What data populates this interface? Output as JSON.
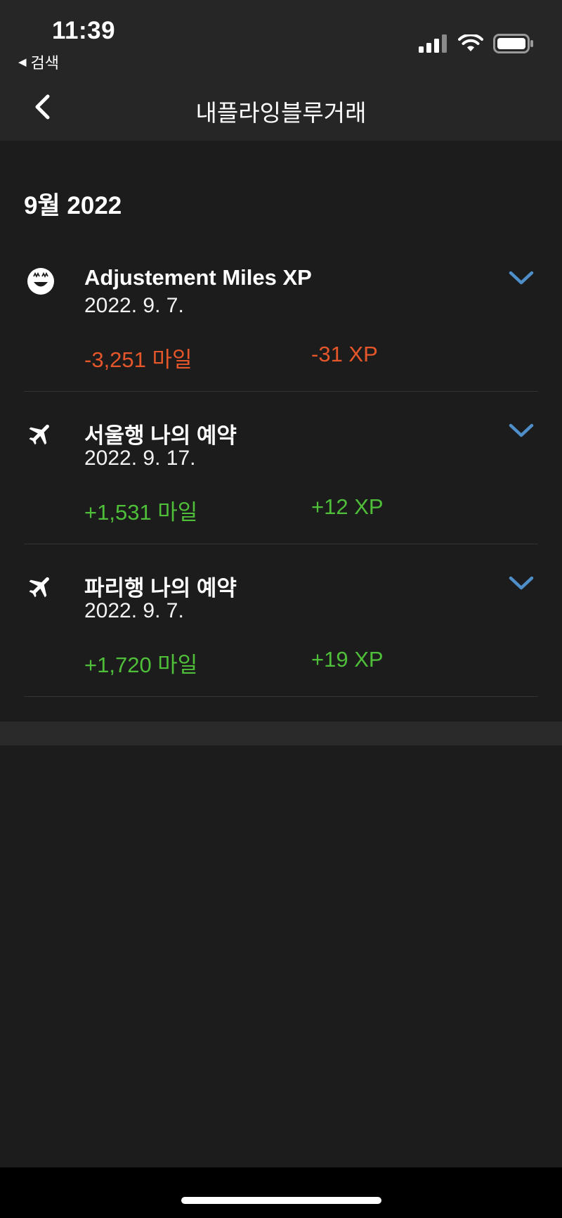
{
  "status_bar": {
    "time": "11:39",
    "back_label": "검색",
    "icons": [
      "cellular-signal-icon",
      "wifi-icon",
      "battery-icon"
    ]
  },
  "nav": {
    "title": "내플라잉블루거래",
    "back_icon": "chevron-left-icon"
  },
  "month_header": "9월 2022",
  "transactions": [
    {
      "icon": "smiley-icon",
      "title": "Adjustement Miles XP",
      "date": "2022. 9. 7.",
      "miles": "-3,251 마일",
      "xp": "-31 XP",
      "sign": "negative"
    },
    {
      "icon": "airplane-icon",
      "title": "서울행 나의 예약",
      "date": "2022. 9. 17.",
      "miles": "+1,531 마일",
      "xp": "+12 XP",
      "sign": "positive"
    },
    {
      "icon": "airplane-icon",
      "title": "파리행 나의 예약",
      "date": "2022. 9. 7.",
      "miles": "+1,720 마일",
      "xp": "+19 XP",
      "sign": "positive"
    }
  ],
  "colors": {
    "negative": "#e5562a",
    "positive": "#4fbf3a",
    "chevron": "#4f8fc9",
    "background": "#1c1c1c",
    "header": "#262626"
  }
}
